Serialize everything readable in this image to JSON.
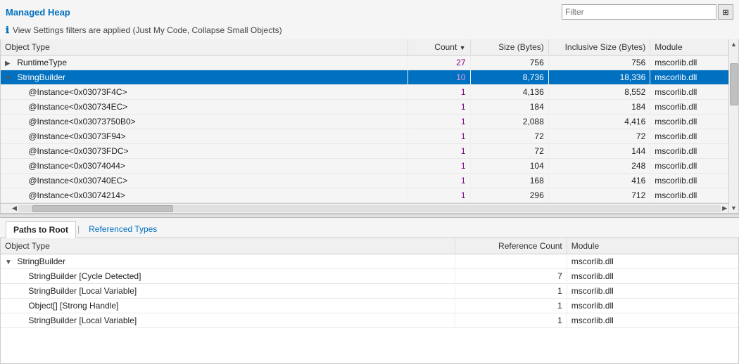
{
  "header": {
    "title": "Managed Heap",
    "filter_placeholder": "Filter",
    "filter_icon": "⊞"
  },
  "info_bar": {
    "text": "View Settings filters are applied (Just My Code, Collapse Small Objects)"
  },
  "upper_table": {
    "columns": [
      {
        "key": "object_type",
        "label": "Object Type"
      },
      {
        "key": "count",
        "label": "Count",
        "sort": "desc"
      },
      {
        "key": "size_bytes",
        "label": "Size (Bytes)"
      },
      {
        "key": "inclusive_size_bytes",
        "label": "Inclusive Size (Bytes)"
      },
      {
        "key": "module",
        "label": "Module"
      }
    ],
    "rows": [
      {
        "indent": 0,
        "expand": "▶",
        "object_type": "RuntimeType",
        "count": "27",
        "size_bytes": "756",
        "inclusive_size_bytes": "756",
        "module": "mscorlib.dll",
        "selected": false
      },
      {
        "indent": 0,
        "expand": "▼",
        "object_type": "StringBuilder",
        "count": "10",
        "size_bytes": "8,736",
        "inclusive_size_bytes": "18,336",
        "module": "mscorlib.dll",
        "selected": true
      },
      {
        "indent": 1,
        "expand": "",
        "object_type": "@Instance<0x03073F4C>",
        "count": "1",
        "size_bytes": "4,136",
        "inclusive_size_bytes": "8,552",
        "module": "mscorlib.dll",
        "selected": false
      },
      {
        "indent": 1,
        "expand": "",
        "object_type": "@Instance<0x030734EC>",
        "count": "1",
        "size_bytes": "184",
        "inclusive_size_bytes": "184",
        "module": "mscorlib.dll",
        "selected": false
      },
      {
        "indent": 1,
        "expand": "",
        "object_type": "@Instance<0x03073750B0>",
        "count": "1",
        "size_bytes": "2,088",
        "inclusive_size_bytes": "4,416",
        "module": "mscorlib.dll",
        "selected": false
      },
      {
        "indent": 1,
        "expand": "",
        "object_type": "@Instance<0x03073F94>",
        "count": "1",
        "size_bytes": "72",
        "inclusive_size_bytes": "72",
        "module": "mscorlib.dll",
        "selected": false
      },
      {
        "indent": 1,
        "expand": "",
        "object_type": "@Instance<0x03073FDC>",
        "count": "1",
        "size_bytes": "72",
        "inclusive_size_bytes": "144",
        "module": "mscorlib.dll",
        "selected": false
      },
      {
        "indent": 1,
        "expand": "",
        "object_type": "@Instance<0x03074044>",
        "count": "1",
        "size_bytes": "104",
        "inclusive_size_bytes": "248",
        "module": "mscorlib.dll",
        "selected": false
      },
      {
        "indent": 1,
        "expand": "",
        "object_type": "@Instance<0x030740EC>",
        "count": "1",
        "size_bytes": "168",
        "inclusive_size_bytes": "416",
        "module": "mscorlib.dll",
        "selected": false
      },
      {
        "indent": 1,
        "expand": "",
        "object_type": "@Instance<0x03074214>",
        "count": "1",
        "size_bytes": "296",
        "inclusive_size_bytes": "712",
        "module": "mscorlib.dll",
        "selected": false
      }
    ]
  },
  "tabs": [
    {
      "label": "Paths to Root",
      "active": true
    },
    {
      "label": "Referenced Types",
      "active": false
    }
  ],
  "lower_table": {
    "columns": [
      {
        "key": "object_type",
        "label": "Object Type"
      },
      {
        "key": "reference_count",
        "label": "Reference Count"
      },
      {
        "key": "module",
        "label": "Module"
      }
    ],
    "rows": [
      {
        "indent": 0,
        "expand": "▼",
        "object_type": "StringBuilder",
        "reference_count": "",
        "module": "mscorlib.dll"
      },
      {
        "indent": 1,
        "expand": "",
        "object_type": "StringBuilder [Cycle Detected]",
        "reference_count": "7",
        "module": "mscorlib.dll"
      },
      {
        "indent": 1,
        "expand": "",
        "object_type": "StringBuilder [Local Variable]",
        "reference_count": "1",
        "module": "mscorlib.dll"
      },
      {
        "indent": 1,
        "expand": "",
        "object_type": "Object[] [Strong Handle]",
        "reference_count": "1",
        "module": "mscorlib.dll"
      },
      {
        "indent": 1,
        "expand": "",
        "object_type": "StringBuilder [Local Variable]",
        "reference_count": "1",
        "module": "mscorlib.dll"
      }
    ]
  }
}
